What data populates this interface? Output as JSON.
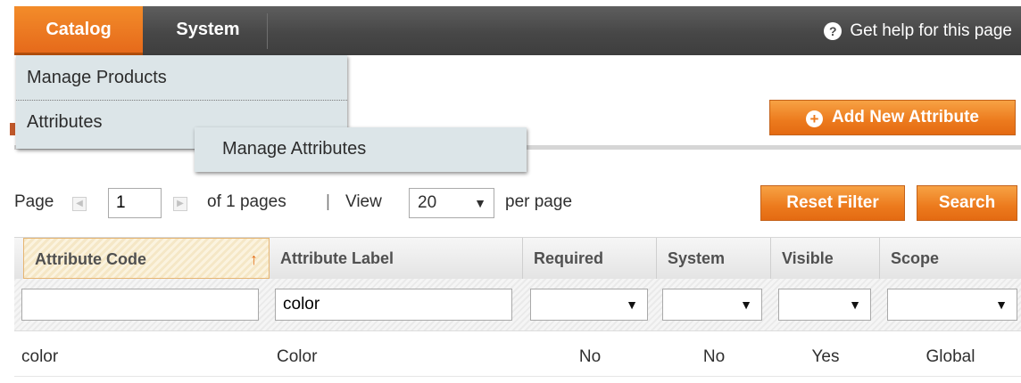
{
  "nav": {
    "catalog_label": "Catalog",
    "system_label": "System",
    "help_label": "Get help for this page",
    "help_icon_glyph": "?"
  },
  "menu": {
    "manage_products": "Manage Products",
    "attributes": "Attributes",
    "flyout_manage_attributes": "Manage Attributes"
  },
  "actions": {
    "add_new_attribute": "Add New Attribute",
    "add_icon_glyph": "+",
    "reset_filter": "Reset Filter",
    "search": "Search"
  },
  "pager": {
    "page_label": "Page",
    "page_value": "1",
    "of_pages": "of 1 pages",
    "separator": "|",
    "view_label": "View",
    "view_value": "20",
    "per_page": "per page"
  },
  "grid": {
    "columns": [
      "Attribute Code",
      "Attribute Label",
      "Required",
      "System",
      "Visible",
      "Scope"
    ],
    "sorted_column_index": 0,
    "sort_glyph": "↑",
    "filters": {
      "attribute_code": "",
      "attribute_label": "color",
      "required": "",
      "system": "",
      "visible": "",
      "scope": ""
    },
    "rows": [
      {
        "attribute_code": "color",
        "attribute_label": "Color",
        "required": "No",
        "system": "No",
        "visible": "Yes",
        "scope": "Global"
      }
    ]
  },
  "colors": {
    "accent_orange": "#ec7a1d",
    "nav_dark": "#474747",
    "menu_bg": "#dce5e8"
  }
}
